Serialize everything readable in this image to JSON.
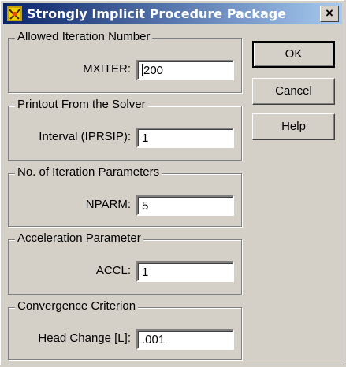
{
  "window": {
    "title": "Strongly Implicit Procedure Package",
    "close_label": "×"
  },
  "buttons": {
    "ok": "OK",
    "cancel": "Cancel",
    "help": "Help"
  },
  "groups": [
    {
      "legend": "Allowed Iteration Number",
      "label": "MXITER:",
      "value": "200"
    },
    {
      "legend": "Printout From the Solver",
      "label": "Interval (IPRSIP):",
      "value": "1"
    },
    {
      "legend": "No. of Iteration Parameters",
      "label": "NPARM:",
      "value": "5"
    },
    {
      "legend": "Acceleration Parameter",
      "label": "ACCL:",
      "value": "1"
    },
    {
      "legend": "Convergence Criterion",
      "label": "Head Change [L]:",
      "value": ".001"
    }
  ]
}
